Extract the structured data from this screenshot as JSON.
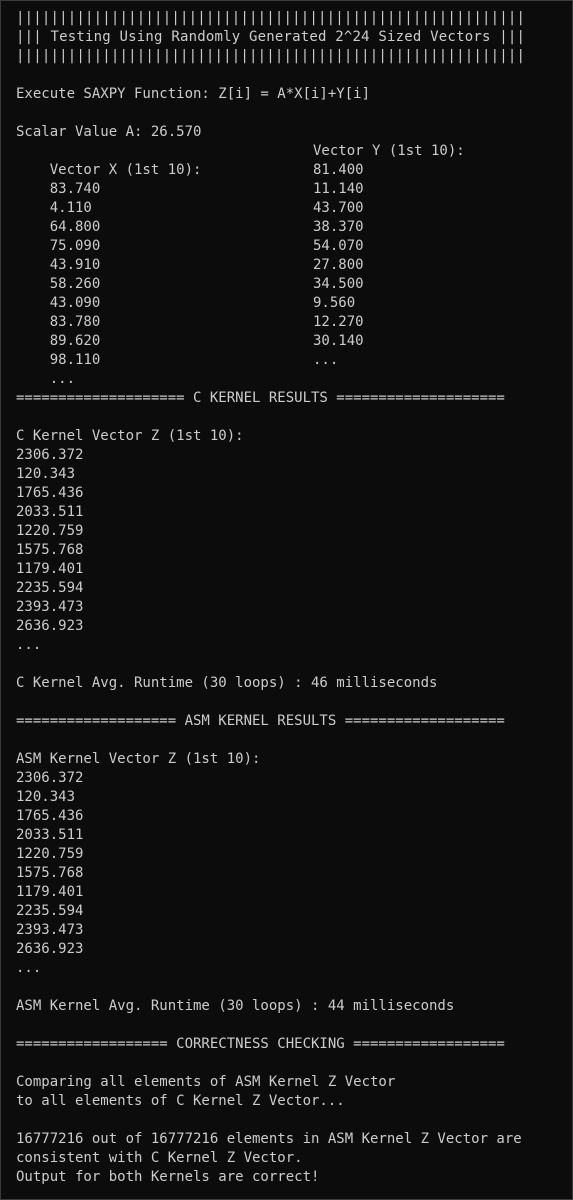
{
  "console": {
    "banner": {
      "bar": "|||||||||||||||||||||||||||||||||||||||||||||||||||||||||||",
      "title": "||| Testing Using Randomly Generated 2^24 Sized Vectors |||"
    },
    "execute_line": "Execute SAXPY Function: Z[i] = A*X[i]+Y[i]",
    "scalar_line": "Scalar Value A: 26.570",
    "vector_x": {
      "header": "Vector X (1st 10):",
      "values": [
        "83.740",
        "4.110",
        "64.800",
        "75.090",
        "43.910",
        "58.260",
        "43.090",
        "83.780",
        "89.620",
        "98.110",
        "..."
      ]
    },
    "vector_y": {
      "header": "Vector Y (1st 10):",
      "values": [
        "81.400",
        "11.140",
        "43.700",
        "38.370",
        "54.070",
        "27.800",
        "34.500",
        "9.560",
        "12.270",
        "30.140",
        "..."
      ]
    },
    "c_kernel": {
      "separator": "==================== C KERNEL RESULTS ====================",
      "header": "C Kernel Vector Z (1st 10):",
      "values": [
        "2306.372",
        "120.343",
        "1765.436",
        "2033.511",
        "1220.759",
        "1575.768",
        "1179.401",
        "2235.594",
        "2393.473",
        "2636.923",
        "..."
      ],
      "runtime": "C Kernel Avg. Runtime (30 loops) : 46 milliseconds"
    },
    "asm_kernel": {
      "separator": "=================== ASM KERNEL RESULTS ===================",
      "header": "ASM Kernel Vector Z (1st 10):",
      "values": [
        "2306.372",
        "120.343",
        "1765.436",
        "2033.511",
        "1220.759",
        "1575.768",
        "1179.401",
        "2235.594",
        "2393.473",
        "2636.923",
        "..."
      ],
      "runtime": "ASM Kernel Avg. Runtime (30 loops) : 44 milliseconds"
    },
    "correctness": {
      "separator": "================== CORRECTNESS CHECKING ==================",
      "lines": [
        "Comparing all elements of ASM Kernel Z Vector",
        "to all elements of C Kernel Z Vector...",
        "",
        "16777216 out of 16777216 elements in ASM Kernel Z Vector are",
        "consistent with C Kernel Z Vector.",
        "Output for both Kernels are correct!"
      ]
    }
  },
  "colors": {
    "background": "#0c0c0c",
    "text": "#cccccc"
  }
}
